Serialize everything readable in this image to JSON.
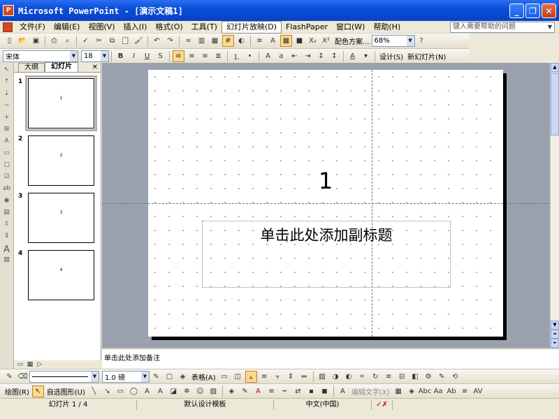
{
  "window": {
    "title": "Microsoft PowerPoint - [演示文稿1]",
    "app_icon": "powerpoint-icon",
    "controls": [
      "minimize",
      "restore",
      "close"
    ]
  },
  "menubar": {
    "items": [
      {
        "label": "文件(F)"
      },
      {
        "label": "编辑(E)"
      },
      {
        "label": "视图(V)"
      },
      {
        "label": "插入(I)"
      },
      {
        "label": "格式(O)"
      },
      {
        "label": "工具(T)"
      },
      {
        "label": "幻灯片放映(D)"
      },
      {
        "label": "FlashPaper"
      },
      {
        "label": "窗口(W)"
      },
      {
        "label": "帮助(H)"
      }
    ],
    "help_placeholder": "键入需要帮助的问题"
  },
  "standard_toolbar": {
    "color_scheme_label": "配色方案...",
    "zoom": "68%"
  },
  "formatting_toolbar": {
    "font": "宋体",
    "size": "18",
    "design_label": "设计(S)",
    "new_slide_label": "新幻灯片(N)"
  },
  "outline_pane": {
    "tabs": [
      {
        "label": "大纲"
      },
      {
        "label": "幻灯片"
      }
    ],
    "slides": [
      {
        "num": "1",
        "title": "1"
      },
      {
        "num": "2",
        "title": "2"
      },
      {
        "num": "3",
        "title": "3"
      },
      {
        "num": "4",
        "title": "4"
      }
    ]
  },
  "slide": {
    "title": "1",
    "subtitle_placeholder": "单击此处添加副标题"
  },
  "notes": {
    "placeholder": "单击此处添加备注"
  },
  "table_toolbar": {
    "line_weight": "1.0 磅",
    "table_label": "表格(A)"
  },
  "drawing_toolbar": {
    "draw_label": "绘图(R)",
    "autoshapes_label": "自选图形(U)",
    "wordart_label": "编辑文字(X)"
  },
  "statusbar": {
    "slide_info": "幻灯片 1 / 4",
    "template": "默认设计模板",
    "language": "中文(中国)"
  }
}
